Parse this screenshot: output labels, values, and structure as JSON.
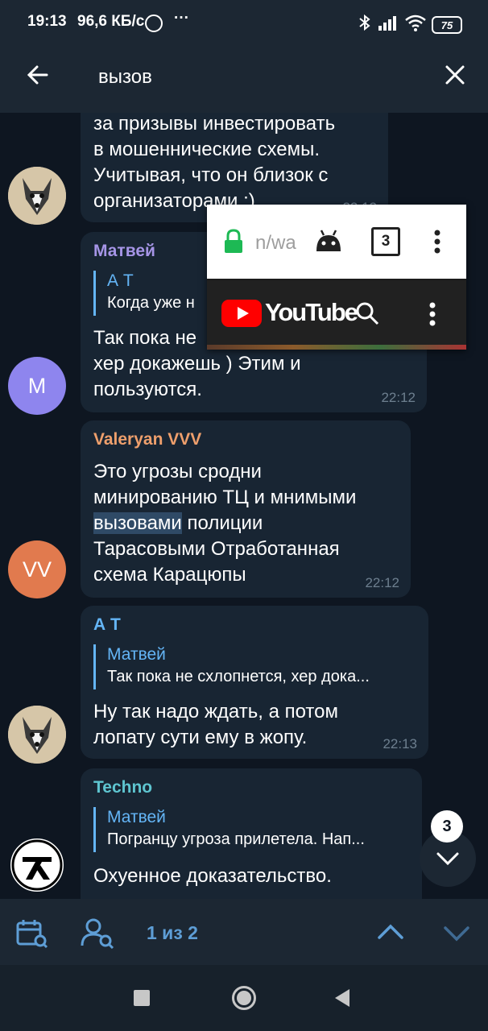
{
  "status_bar": {
    "time": "19:13",
    "speed": "96,6 КБ/с",
    "dots": "···",
    "battery": "75"
  },
  "header": {
    "search_query": "вызов",
    "back_icon": "arrow-left-icon",
    "close_icon": "close-icon"
  },
  "messages": [
    {
      "lines": [
        "за призывы инвестировать",
        "в мошеннические схемы.",
        "Учитывая, что он близок с",
        "организаторами :)"
      ],
      "time": "22:12"
    },
    {
      "sender": "Матвей",
      "sender_color": "#a695e7",
      "reply_name": "А Т",
      "reply_text": "Когда уже н",
      "lines": [
        "Так пока не",
        "хер докажешь ) Этим и",
        "пользуются."
      ],
      "time": "22:12",
      "avatar_letter": "M",
      "avatar_color": "#8e85ee"
    },
    {
      "sender": "Valeryan VVV",
      "sender_color": "#ee9f6c",
      "line1": "Это угрозы сродни",
      "line2": "минированию ТЦ и мнимыми",
      "line3_highlight": "вызовами",
      "line3_rest": " полиции",
      "line4": "Тарасовыми Отработанная",
      "line5": "схема Карацюпы",
      "time": "22:12",
      "avatar_letter": "VV",
      "avatar_color": "#e17a4e"
    },
    {
      "sender": "А Т",
      "sender_color": "#64b5f6",
      "reply_name": "Матвей",
      "reply_text": "Так пока не схлопнется, хер дока...",
      "lines": [
        "Ну так надо ждать, а потом",
        "лопату сути ему в жопу."
      ],
      "time": "22:13"
    },
    {
      "sender": "Techno",
      "sender_color": "#5ec5d0",
      "reply_name": "Матвей",
      "reply_text": "Погранцу угроза прилетела. Нап...",
      "lines": [
        "Охуенное доказательство."
      ]
    }
  ],
  "popup": {
    "url": "n/wa",
    "tab_count": "3",
    "youtube_label": "YouTube"
  },
  "scroll_badge": "3",
  "search_nav": {
    "counter": "1 из 2"
  },
  "colors": {
    "background": "#0e1621",
    "bubble": "#182533",
    "accent": "#64b5f6"
  }
}
